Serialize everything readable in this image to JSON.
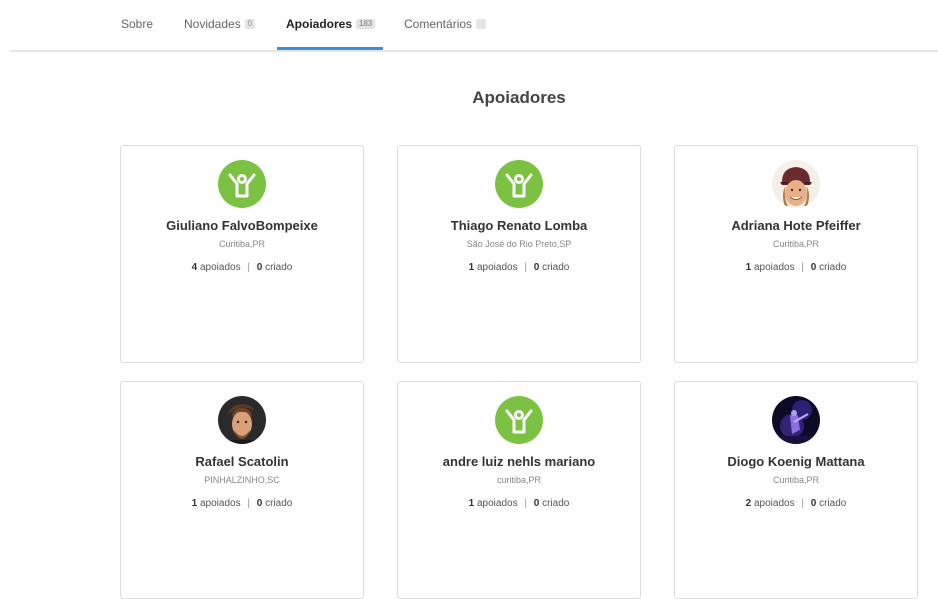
{
  "tabs": [
    {
      "label": "Sobre"
    },
    {
      "label": "Novidades",
      "badge": "0"
    },
    {
      "label": "Apoiadores",
      "badge": "183",
      "active": true
    },
    {
      "label": "Comentários",
      "badge": ""
    }
  ],
  "section": {
    "title": "Apoiadores"
  },
  "stats_labels": {
    "backed": "apoiados",
    "created": "criado",
    "separator": "|"
  },
  "supporters": [
    {
      "name": "Giuliano FalvoBompeixe",
      "location": "Curitiba,PR",
      "backed": "4",
      "created": "0",
      "avatar": "default-supporter-icon"
    },
    {
      "name": "Thiago Renato Lomba",
      "location": "São José do Rio Preto,SP",
      "backed": "1",
      "created": "0",
      "avatar": "default-supporter-icon"
    },
    {
      "name": "Adriana Hote Pfeiffer",
      "location": "Curitiba,PR",
      "backed": "1",
      "created": "0",
      "avatar": "photo-woman-hat"
    },
    {
      "name": "Rafael Scatolin",
      "location": "PINHALZINHO,SC",
      "backed": "1",
      "created": "0",
      "avatar": "photo-man"
    },
    {
      "name": "andre luiz nehls mariano",
      "location": "curitiba,PR",
      "backed": "1",
      "created": "0",
      "avatar": "default-supporter-icon"
    },
    {
      "name": "Diogo Koenig Mattana",
      "location": "Curitiba,PR",
      "backed": "2",
      "created": "0",
      "avatar": "photo-concert"
    }
  ],
  "colors": {
    "accent": "#3a8fd8",
    "default_avatar": "#7cc242"
  }
}
